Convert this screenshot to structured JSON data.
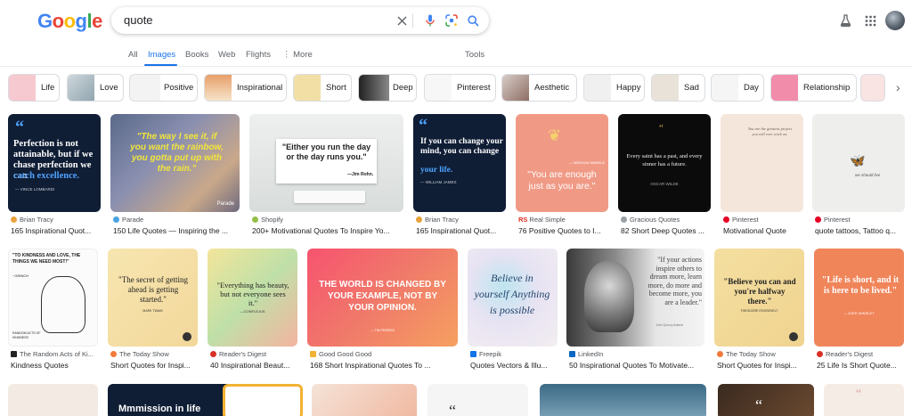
{
  "search": {
    "query": "quote"
  },
  "logo": {
    "letters": [
      "G",
      "o",
      "o",
      "g",
      "l",
      "e"
    ],
    "colors": [
      "#4285f4",
      "#ea4335",
      "#fbbc05",
      "#4285f4",
      "#34a853",
      "#ea4335"
    ]
  },
  "nav": {
    "items": [
      "All",
      "Images",
      "Books",
      "Web",
      "Flights",
      "More"
    ],
    "tools": "Tools",
    "active": "Images"
  },
  "chips": [
    "Life",
    "Love",
    "Positive",
    "Inspirational",
    "Short",
    "Deep",
    "Pinterest",
    "Aesthetic",
    "Happy",
    "Sad",
    "Day",
    "Relationship"
  ],
  "row1": [
    {
      "source": "Brian Tracy",
      "caption": "165 Inspirational Quot...",
      "quote": "Perfection is not attainable, but if we chase perfection we can",
      "quote_hl": "catch excellence.",
      "author": "— VINCE LOMBARDI"
    },
    {
      "source": "Parade",
      "caption": "150 Life Quotes — Inspiring the ...",
      "quote": "\"The way I see it, if you want the rainbow, you gotta put up with the rain.\"",
      "brand": "Parade"
    },
    {
      "source": "Shopify",
      "caption": "200+ Motivational Quotes To Inspire Yo...",
      "quote": "\"Either you run the day or the day runs you.\"",
      "author": "—Jim Rohn."
    },
    {
      "source": "Brian Tracy",
      "caption": "165 Inspirational Quot...",
      "quote": "If you can change your mind, you can change",
      "quote_hl": "your life.",
      "author": "— WILLIAM JAMES"
    },
    {
      "source": "Real Simple",
      "caption": "76 Positive Quotes to I...",
      "quote": "\"You are enough just as you are.\"",
      "author": "— MEGHAN MARKLE"
    },
    {
      "source": "Gracious Quotes",
      "caption": "82 Short Deep Quotes ...",
      "quote": "Every saint has a past, and every sinner has a future.",
      "author": "OSCAR WILDE"
    },
    {
      "source": "Pinterest",
      "caption": "Motivational Quote",
      "quote": "You are the greatest project you will ever work on."
    },
    {
      "source": "Pinterest",
      "caption": "quote tattoos, Tattoo q...",
      "quote": "we should live"
    }
  ],
  "row2": [
    {
      "source": "The Random Acts of Ki...",
      "caption": "Kindness Quotes",
      "quote": "\"TO KINDNESS AND LOVE, THE THINGS WE NEED MOST!\"",
      "author": "~GRINCH",
      "footer": "RANDOM ACTS OF KINDNESS"
    },
    {
      "source": "The Today Show",
      "caption": "Short Quotes for Inspi...",
      "quote": "\"The secret of getting ahead is getting started.\"",
      "author": "MARK TWAIN"
    },
    {
      "source": "Reader's Digest",
      "caption": "40 Inspirational Beaut...",
      "quote": "\"Everything has beauty, but not everyone sees it.\"",
      "author": "—CONFUCIUS"
    },
    {
      "source": "Good Good Good",
      "caption": "168 Short Inspirational Quotes To ...",
      "quote": "THE WORLD IS CHANGED BY YOUR EXAMPLE, NOT BY YOUR OPINION.",
      "author": "— TIM FERRISS"
    },
    {
      "source": "Freepik",
      "caption": "Quotes Vectors & Illu...",
      "quote": "Believe in yourself Anything is possible"
    },
    {
      "source": "LinkedIn",
      "caption": "50 Inspirational Quotes To Motivate...",
      "quote": "\"If your actions inspire others to dream more, learn more, do more and become more, you are a leader.\"",
      "author": "John Quincy Adams"
    },
    {
      "source": "The Today Show",
      "caption": "Short Quotes for Inspi...",
      "quote": "\"Believe you can and you're halfway there.\"",
      "author": "THEODORE ROOSEVELT"
    },
    {
      "source": "Reader's Digest",
      "caption": "25 Life Is Short Quote...",
      "quote": "\"Life is short, and it is here to be lived.\"",
      "author": "— KATE WINSLET"
    }
  ],
  "row3": [
    {
      "quote": ""
    },
    {
      "quote": "Mmmission in life"
    },
    {
      "quote": ""
    },
    {
      "quote": ""
    },
    {
      "quote": ""
    },
    {
      "quote": ""
    },
    {
      "quote": ""
    },
    {
      "quote": ""
    }
  ]
}
